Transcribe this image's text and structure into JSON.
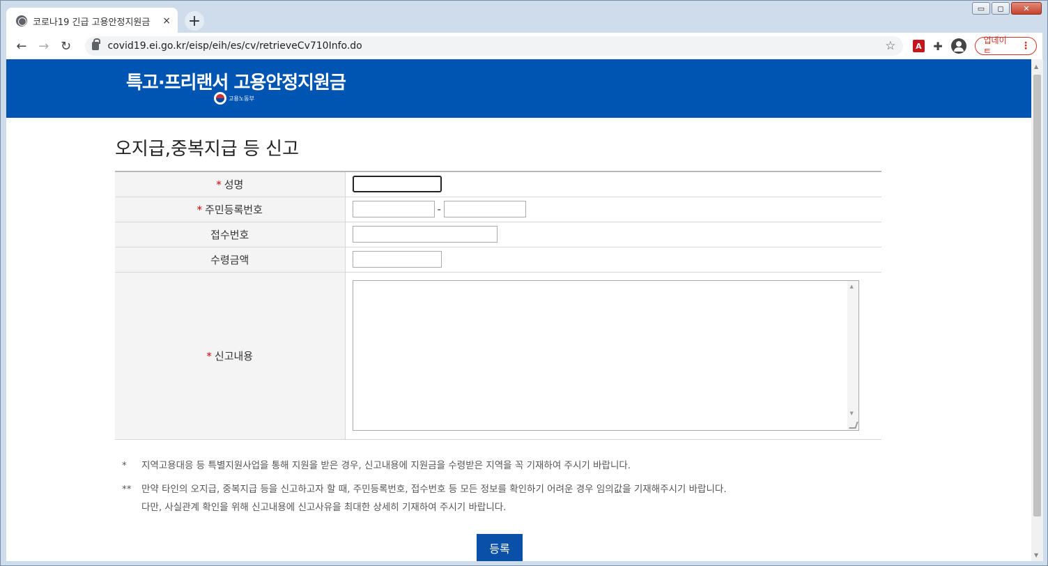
{
  "browser": {
    "tab_title": "코로나19 긴급 고용안정지원금",
    "tab_close": "×",
    "new_tab": "+",
    "url": "covid19.ei.go.kr/eisp/eih/es/cv/retrieveCv710Info.do",
    "update_label": "업데이트",
    "update_menu": "⋮",
    "back": "←",
    "forward": "→",
    "reload": "↻",
    "star": "☆",
    "puzzle": "✚"
  },
  "window": {
    "minimize": "▭",
    "maximize": "◻",
    "close": "✕"
  },
  "banner": {
    "title": "특고·프리랜서 고용안정지원금",
    "ministry": "고용노동부"
  },
  "page": {
    "title": "오지급,중복지급 등 신고",
    "required_mark": "*",
    "fields": {
      "name": "성명",
      "resident_number": "주민등록번호",
      "resident_dash": "-",
      "receipt_number": "접수번호",
      "amount": "수령금액",
      "content": "신고내용"
    },
    "notes": [
      {
        "mark": "*",
        "lines": [
          "지역고용대응 등 특별지원사업을 통해 지원을 받은 경우, 신고내용에 지원금을 수령받은 지역을 꼭 기재하여 주시기 바랍니다."
        ]
      },
      {
        "mark": "**",
        "lines": [
          "만약 타인의 오지급, 중복지급 등을 신고하고자 할 때, 주민등록번호, 접수번호 등 모든 정보를 확인하기 어려운 경우 임의값을 기재해주시기 바랍니다.",
          "다만, 사실관계 확인을 위해 신고내용에 신고사유을 최대한 상세히 기재하여 주시기 바랍니다."
        ]
      }
    ],
    "submit_label": "등록"
  },
  "colors": {
    "banner": "#0055b2",
    "required": "#d20000",
    "button": "#0a4fa8"
  }
}
